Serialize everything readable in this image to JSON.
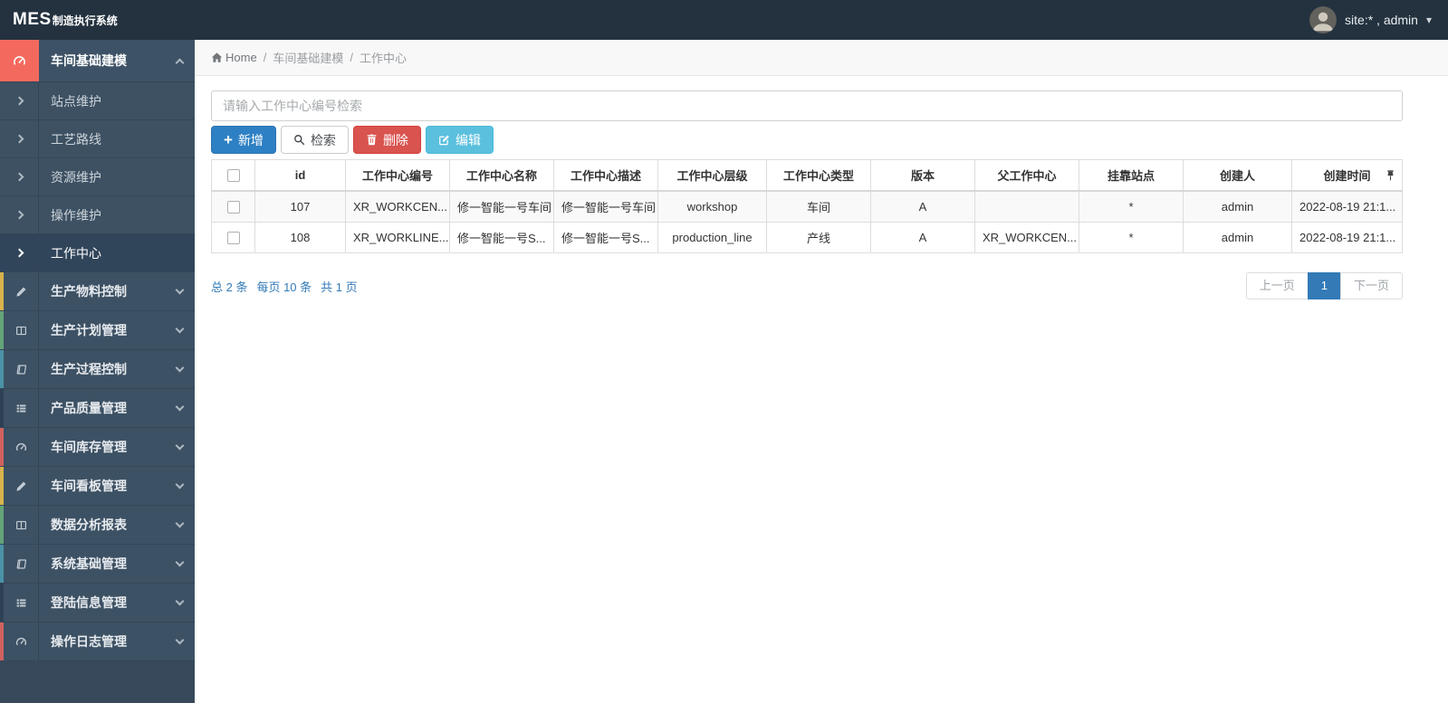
{
  "topbar": {
    "logo_primary": "MES",
    "logo_secondary": "制造执行系统",
    "user_label": "site:* , admin"
  },
  "breadcrumb": {
    "home": "Home",
    "sep": "/",
    "level1": "车间基础建模",
    "level2": "工作中心"
  },
  "sidebar": {
    "group": {
      "label": "车间基础建模"
    },
    "submenu": [
      {
        "label": "站点维护"
      },
      {
        "label": "工艺路线"
      },
      {
        "label": "资源维护"
      },
      {
        "label": "操作维护"
      },
      {
        "label": "工作中心"
      }
    ],
    "modules": [
      {
        "label": "生产物料控制",
        "icon": "pencil-icon",
        "accent": "#d9b24b"
      },
      {
        "label": "生产计划管理",
        "icon": "columns-icon",
        "accent": "#64a478"
      },
      {
        "label": "生产过程控制",
        "icon": "book-icon",
        "accent": "#4a92a7"
      },
      {
        "label": "产品质量管理",
        "icon": "list-icon",
        "accent": "#2e4154"
      },
      {
        "label": "车间库存管理",
        "icon": "dashboard-icon",
        "accent": "#d0625f"
      },
      {
        "label": "车间看板管理",
        "icon": "pencil-icon",
        "accent": "#d9b24b"
      },
      {
        "label": "数据分析报表",
        "icon": "columns-icon",
        "accent": "#64a478"
      },
      {
        "label": "系统基础管理",
        "icon": "book-icon",
        "accent": "#4a92a7"
      },
      {
        "label": "登陆信息管理",
        "icon": "list-icon",
        "accent": "#2e4154"
      },
      {
        "label": "操作日志管理",
        "icon": "dashboard-icon",
        "accent": "#d0625f"
      }
    ]
  },
  "toolbar": {
    "search_placeholder": "请输入工作中心编号检索",
    "add_label": "新增",
    "search_label": "检索",
    "delete_label": "删除",
    "edit_label": "编辑"
  },
  "table": {
    "headers": [
      "id",
      "工作中心编号",
      "工作中心名称",
      "工作中心描述",
      "工作中心层级",
      "工作中心类型",
      "版本",
      "父工作中心",
      "挂靠站点",
      "创建人",
      "创建时间"
    ],
    "rows": [
      {
        "cells": [
          "107",
          "XR_WORKCEN...",
          "修一智能一号车间",
          "修一智能一号车间",
          "workshop",
          "车间",
          "A",
          "",
          "*",
          "admin",
          "2022-08-19 21:1..."
        ]
      },
      {
        "cells": [
          "108",
          "XR_WORKLINE...",
          "修一智能一号S...",
          "修一智能一号S...",
          "production_line",
          "产线",
          "A",
          "XR_WORKCEN...",
          "*",
          "admin",
          "2022-08-19 21:1..."
        ]
      }
    ]
  },
  "summary": {
    "total": "总 2 条",
    "per_page": "每页 10 条",
    "pages": "共 1 页"
  },
  "pagination": {
    "prev": "上一页",
    "current": "1",
    "next": "下一页"
  },
  "colors": {
    "primary_blue": "#337ab7",
    "button_blue": "#2e80c4",
    "danger_red": "#d9534f",
    "info_cyan": "#5bc0de",
    "sidebar_active_icon_red": "#f4695e",
    "topbar_dark": "#24323f",
    "sidebar_dark": "#394c5e"
  }
}
